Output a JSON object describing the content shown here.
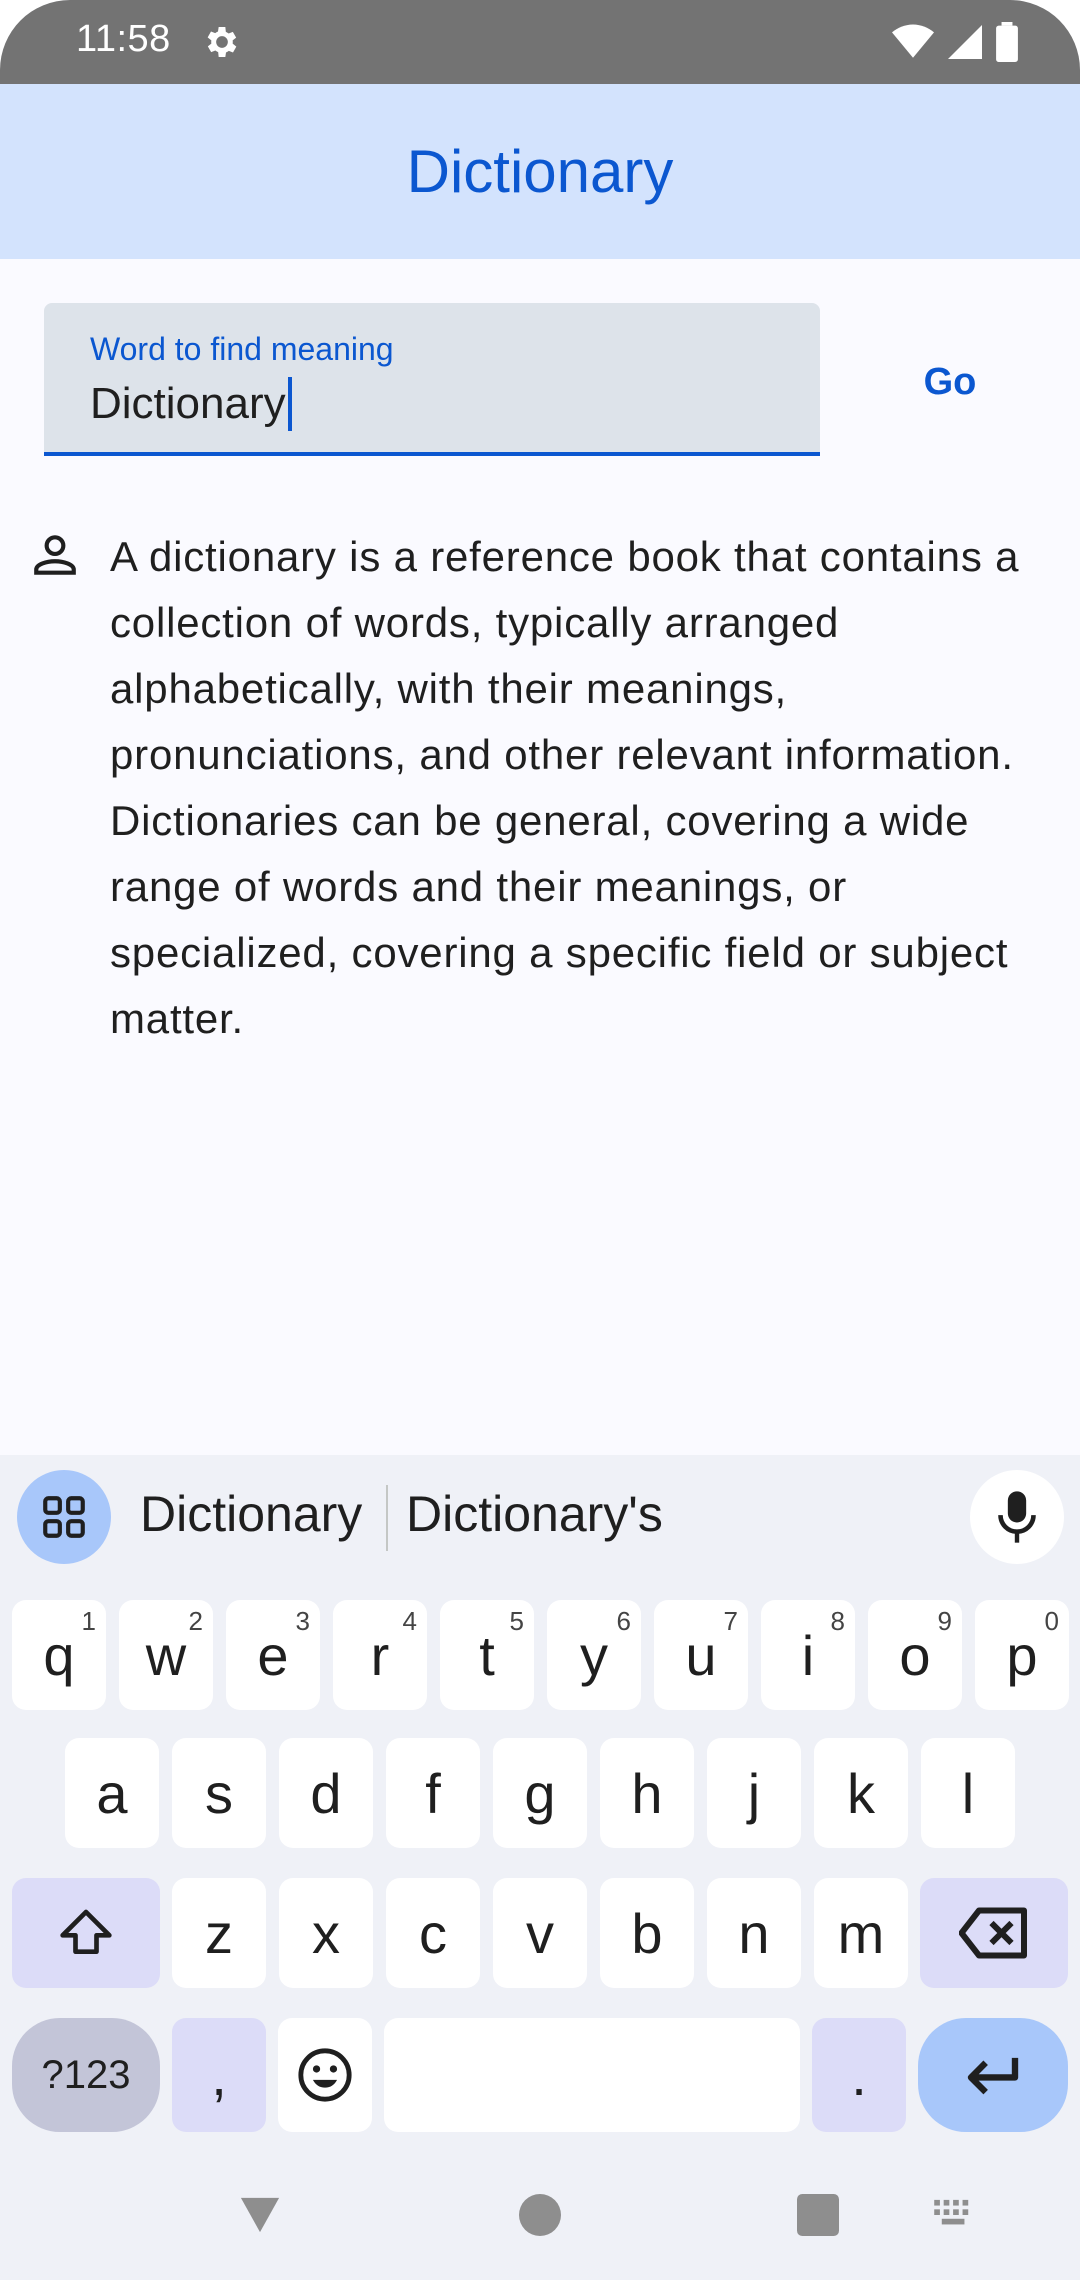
{
  "status_bar": {
    "time": "11:58",
    "icons": [
      "settings-icon",
      "wifi-icon",
      "signal-icon",
      "battery-icon"
    ]
  },
  "app_bar": {
    "title": "Dictionary"
  },
  "search": {
    "label": "Word to find meaning",
    "value": "Dictionary",
    "go_label": "Go"
  },
  "result": {
    "text": "A dictionary is a reference book that contains a collection of words, typically arranged alphabetically, with their meanings, pronunciations, and other relevant information. Dictionaries can be general, covering a wide range of words and their meanings, or specialized, covering a specific field or subject matter."
  },
  "keyboard": {
    "suggestions": [
      "Dictionary",
      "Dictionary's"
    ],
    "row1": [
      "q",
      "w",
      "e",
      "r",
      "t",
      "y",
      "u",
      "i",
      "o",
      "p"
    ],
    "row1_hints": [
      "1",
      "2",
      "3",
      "4",
      "5",
      "6",
      "7",
      "8",
      "9",
      "0"
    ],
    "row2": [
      "a",
      "s",
      "d",
      "f",
      "g",
      "h",
      "j",
      "k",
      "l"
    ],
    "row3": [
      "z",
      "x",
      "c",
      "v",
      "b",
      "n",
      "m"
    ],
    "symbols_label": "?123",
    "comma": ",",
    "period": "."
  },
  "colors": {
    "accent": "#0b57d0",
    "app_bar_bg": "#d3e3fd",
    "status_bar_bg": "#737373"
  }
}
